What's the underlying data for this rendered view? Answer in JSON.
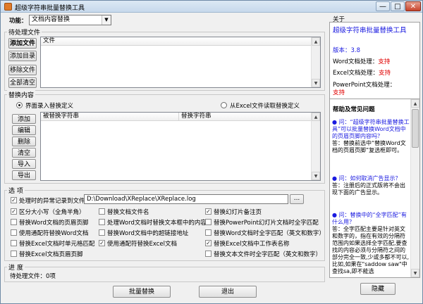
{
  "window": {
    "title": "超级字符串批量替换工具",
    "min_label": "—",
    "max_label": "□",
    "close_label": "✕"
  },
  "function": {
    "label": "功能：",
    "value": "文档内容替换"
  },
  "pending_files": {
    "group_label": "待处理文件",
    "buttons": [
      "添加文件",
      "添加目录",
      "移除文件",
      "全部清空"
    ],
    "column": "文件"
  },
  "replace_content": {
    "group_label": "替换内容",
    "radio_interface": "界面录入替换定义",
    "radio_excel": "从Excel文件读取替换定义",
    "buttons": [
      "添加",
      "编辑",
      "删除",
      "清空",
      "导入",
      "导出"
    ],
    "columns": [
      "被替换字符串",
      "替换字符串"
    ]
  },
  "options": {
    "group_label": "选 项",
    "exception_log_label": "处理时的异常记录到文件:",
    "exception_log_path": "D:\\Download\\XReplace\\XReplace.log",
    "browse_label": "...",
    "checks": [
      {
        "label": "区分大小写（全角半角）",
        "checked": true
      },
      {
        "label": "替换文档文件名",
        "checked": false
      },
      {
        "label": "替换幻灯片备注页",
        "checked": true
      },
      {
        "label": "替换Word文档的页眉页脚",
        "checked": false
      },
      {
        "label": "处理Word文档时替换文本框中的内容",
        "checked": false
      },
      {
        "label": "替换PowerPoint幻灯片文档时全字匹配",
        "checked": false
      },
      {
        "label": "使用通配符替换Word文档",
        "checked": false
      },
      {
        "label": "替换Word文档中的超链接地址",
        "checked": false
      },
      {
        "label": "替换Word文档时全字匹配（英文和数字）",
        "checked": false
      },
      {
        "label": "替换Excel文档时单元格匹配",
        "checked": false
      },
      {
        "label": "使用通配符替换Excel文档",
        "checked": true
      },
      {
        "label": "替换Excel文档中工作表名称",
        "checked": true
      },
      {
        "label": "替换Excel文档页眉页脚",
        "checked": false
      },
      {
        "label": "替换文本文件时全字匹配（英文和数字）",
        "checked": false
      }
    ]
  },
  "progress": {
    "group_label": "进 度",
    "pending_count": "待处理文件：0项"
  },
  "bottom": {
    "batch_replace": "批量替换",
    "exit": "退出",
    "hide": "隐藏"
  },
  "about": {
    "header": "关于",
    "product": "超级字符串批量替换工具",
    "version": "版本：3.8",
    "rows": [
      {
        "label": "Word文档处理：",
        "value": "支持"
      },
      {
        "label": "Excel文档处理：",
        "value": "支持"
      },
      {
        "label": "PowerPoint文档处理：",
        "value": "支持"
      }
    ]
  },
  "help": {
    "header": "帮助及常见问题",
    "items": [
      {
        "q": "问：“超级字符串批量替换工具”可以批量替换Word文档中的页眉页脚内容吗？",
        "a": "答：替换前选中“替换Word文档的页眉页脚”复选框即可。"
      },
      {
        "q": "问：如何取消广告显示？",
        "a": "答：注册后的正式版将不会出现下面的广告显示。"
      },
      {
        "q": "问：替换中的“全字匹配”有什么用？",
        "a": "答：全字匹配主要是针对英文和数字的，指在有效的分隔符范围内如果选择全字匹配,要查找的内容必须与分隔符之间的部分完全一致,少或多都不可以,比如,如果在\"saddow saw\"中查找sa,即不能选"
      }
    ],
    "marker": "●"
  }
}
